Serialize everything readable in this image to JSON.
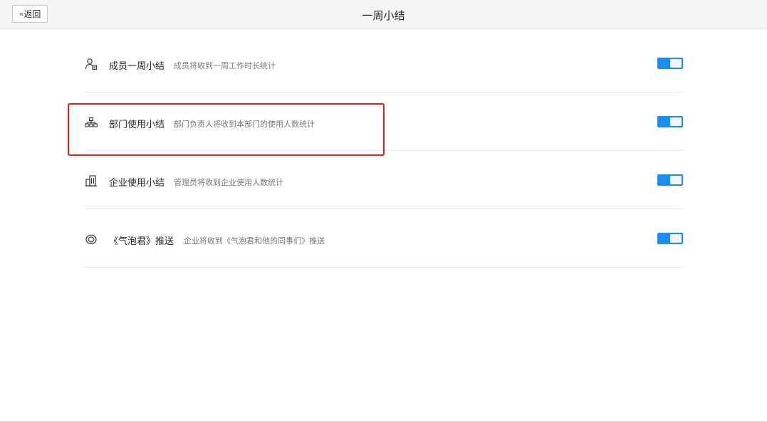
{
  "header": {
    "back_label": "返回",
    "back_chevron": "«",
    "title": "一周小结"
  },
  "rows": [
    {
      "icon": "person-icon",
      "title": "成员一周小结",
      "desc": "成员将收到一周工作时长统计",
      "enabled": true
    },
    {
      "icon": "org-chart-icon",
      "title": "部门使用小结",
      "desc": "部门负责人将收到本部门的使用人数统计",
      "enabled": true
    },
    {
      "icon": "building-icon",
      "title": "企业使用小结",
      "desc": "管理员将收到企业使用人数统计",
      "enabled": true
    },
    {
      "icon": "bubble-icon",
      "title": "《气泡君》推送",
      "desc": "企业将收到《气泡君和他的同事们》推送",
      "enabled": true
    }
  ],
  "colors": {
    "toggle_on": "#1b8cf2",
    "highlight": "#e02020"
  }
}
